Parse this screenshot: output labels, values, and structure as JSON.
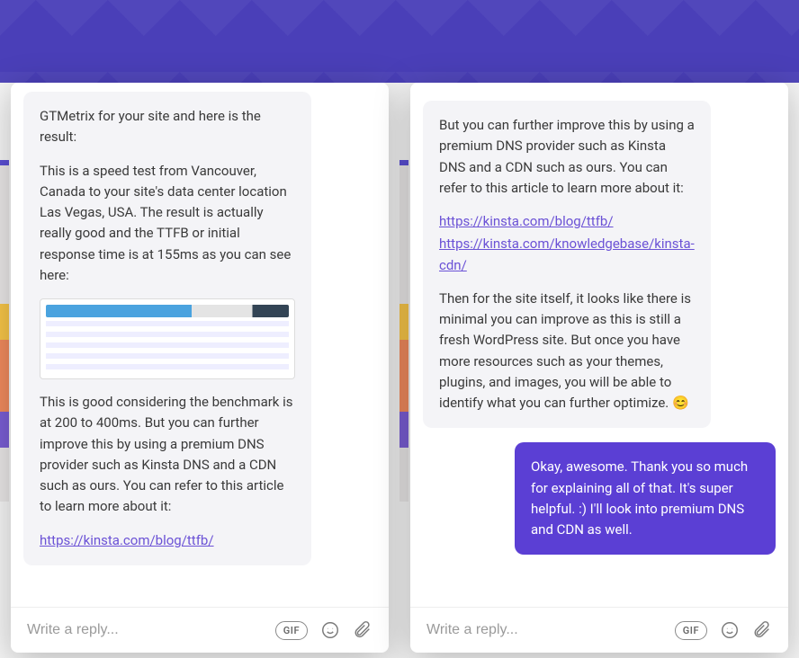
{
  "colors": {
    "accent": "#5b3fd4",
    "agent_bubble": "#f4f4f7",
    "link": "#6b52d6"
  },
  "left": {
    "agent_msg": {
      "p1": "GTMetrix for your site and here is the result:",
      "p2": "This is a speed test from Vancouver, Canada to your site's data center location Las Vegas, USA. The result is actually really good and the TTFB or initial response time is at 155ms as you can see here:",
      "p3": "This is good considering the benchmark is at 200 to 400ms. But you can further improve this by using a premium DNS provider such as Kinsta DNS and a CDN such as ours. You can refer to this article to learn more about it:",
      "link1": "https://kinsta.com/blog/ttfb/"
    },
    "composer": {
      "placeholder": "Write a reply...",
      "gif_label": "GIF"
    }
  },
  "right": {
    "agent_msg": {
      "p0_tail": "But you can further improve this by using a premium DNS provider such as Kinsta DNS and a CDN such as ours. You can refer to this article to learn more about it:",
      "link1": "https://kinsta.com/blog/ttfb/",
      "link2": "https://kinsta.com/knowledgebase/kinsta-cdn/",
      "p2": "Then for the site itself, it looks like there is minimal you can improve as this is still a fresh WordPress site. But once you have more resources such as your themes, plugins, and images, you will be able to identify what you can further optimize. 😊"
    },
    "user_msg": {
      "text": "Okay, awesome. Thank you so much for explaining all of that. It's super helpful. :) I'll look into premium DNS and CDN as well."
    },
    "composer": {
      "placeholder": "Write a reply...",
      "gif_label": "GIF"
    }
  }
}
